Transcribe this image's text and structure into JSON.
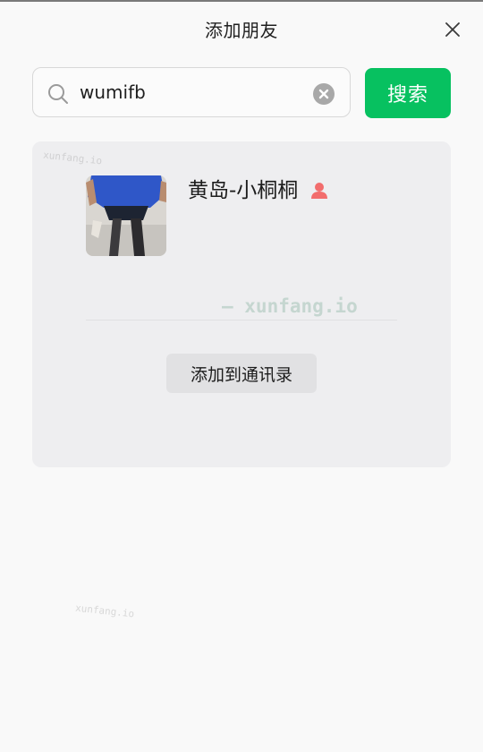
{
  "header": {
    "title": "添加朋友",
    "close_icon": "close-icon"
  },
  "search": {
    "value": "wumifb",
    "search_icon": "search-icon",
    "clear_icon": "clear-icon",
    "button_label": "搜索",
    "button_color": "#07c160"
  },
  "result": {
    "name": "黄岛-小桐桐",
    "gender_icon": "female-user-icon",
    "gender_color": "#f26d6d",
    "add_button_label": "添加到通讯录"
  },
  "watermarks": {
    "main": "— xunfang.io",
    "small_top": "xunfang.io",
    "small_bottom": "xunfang.io"
  }
}
